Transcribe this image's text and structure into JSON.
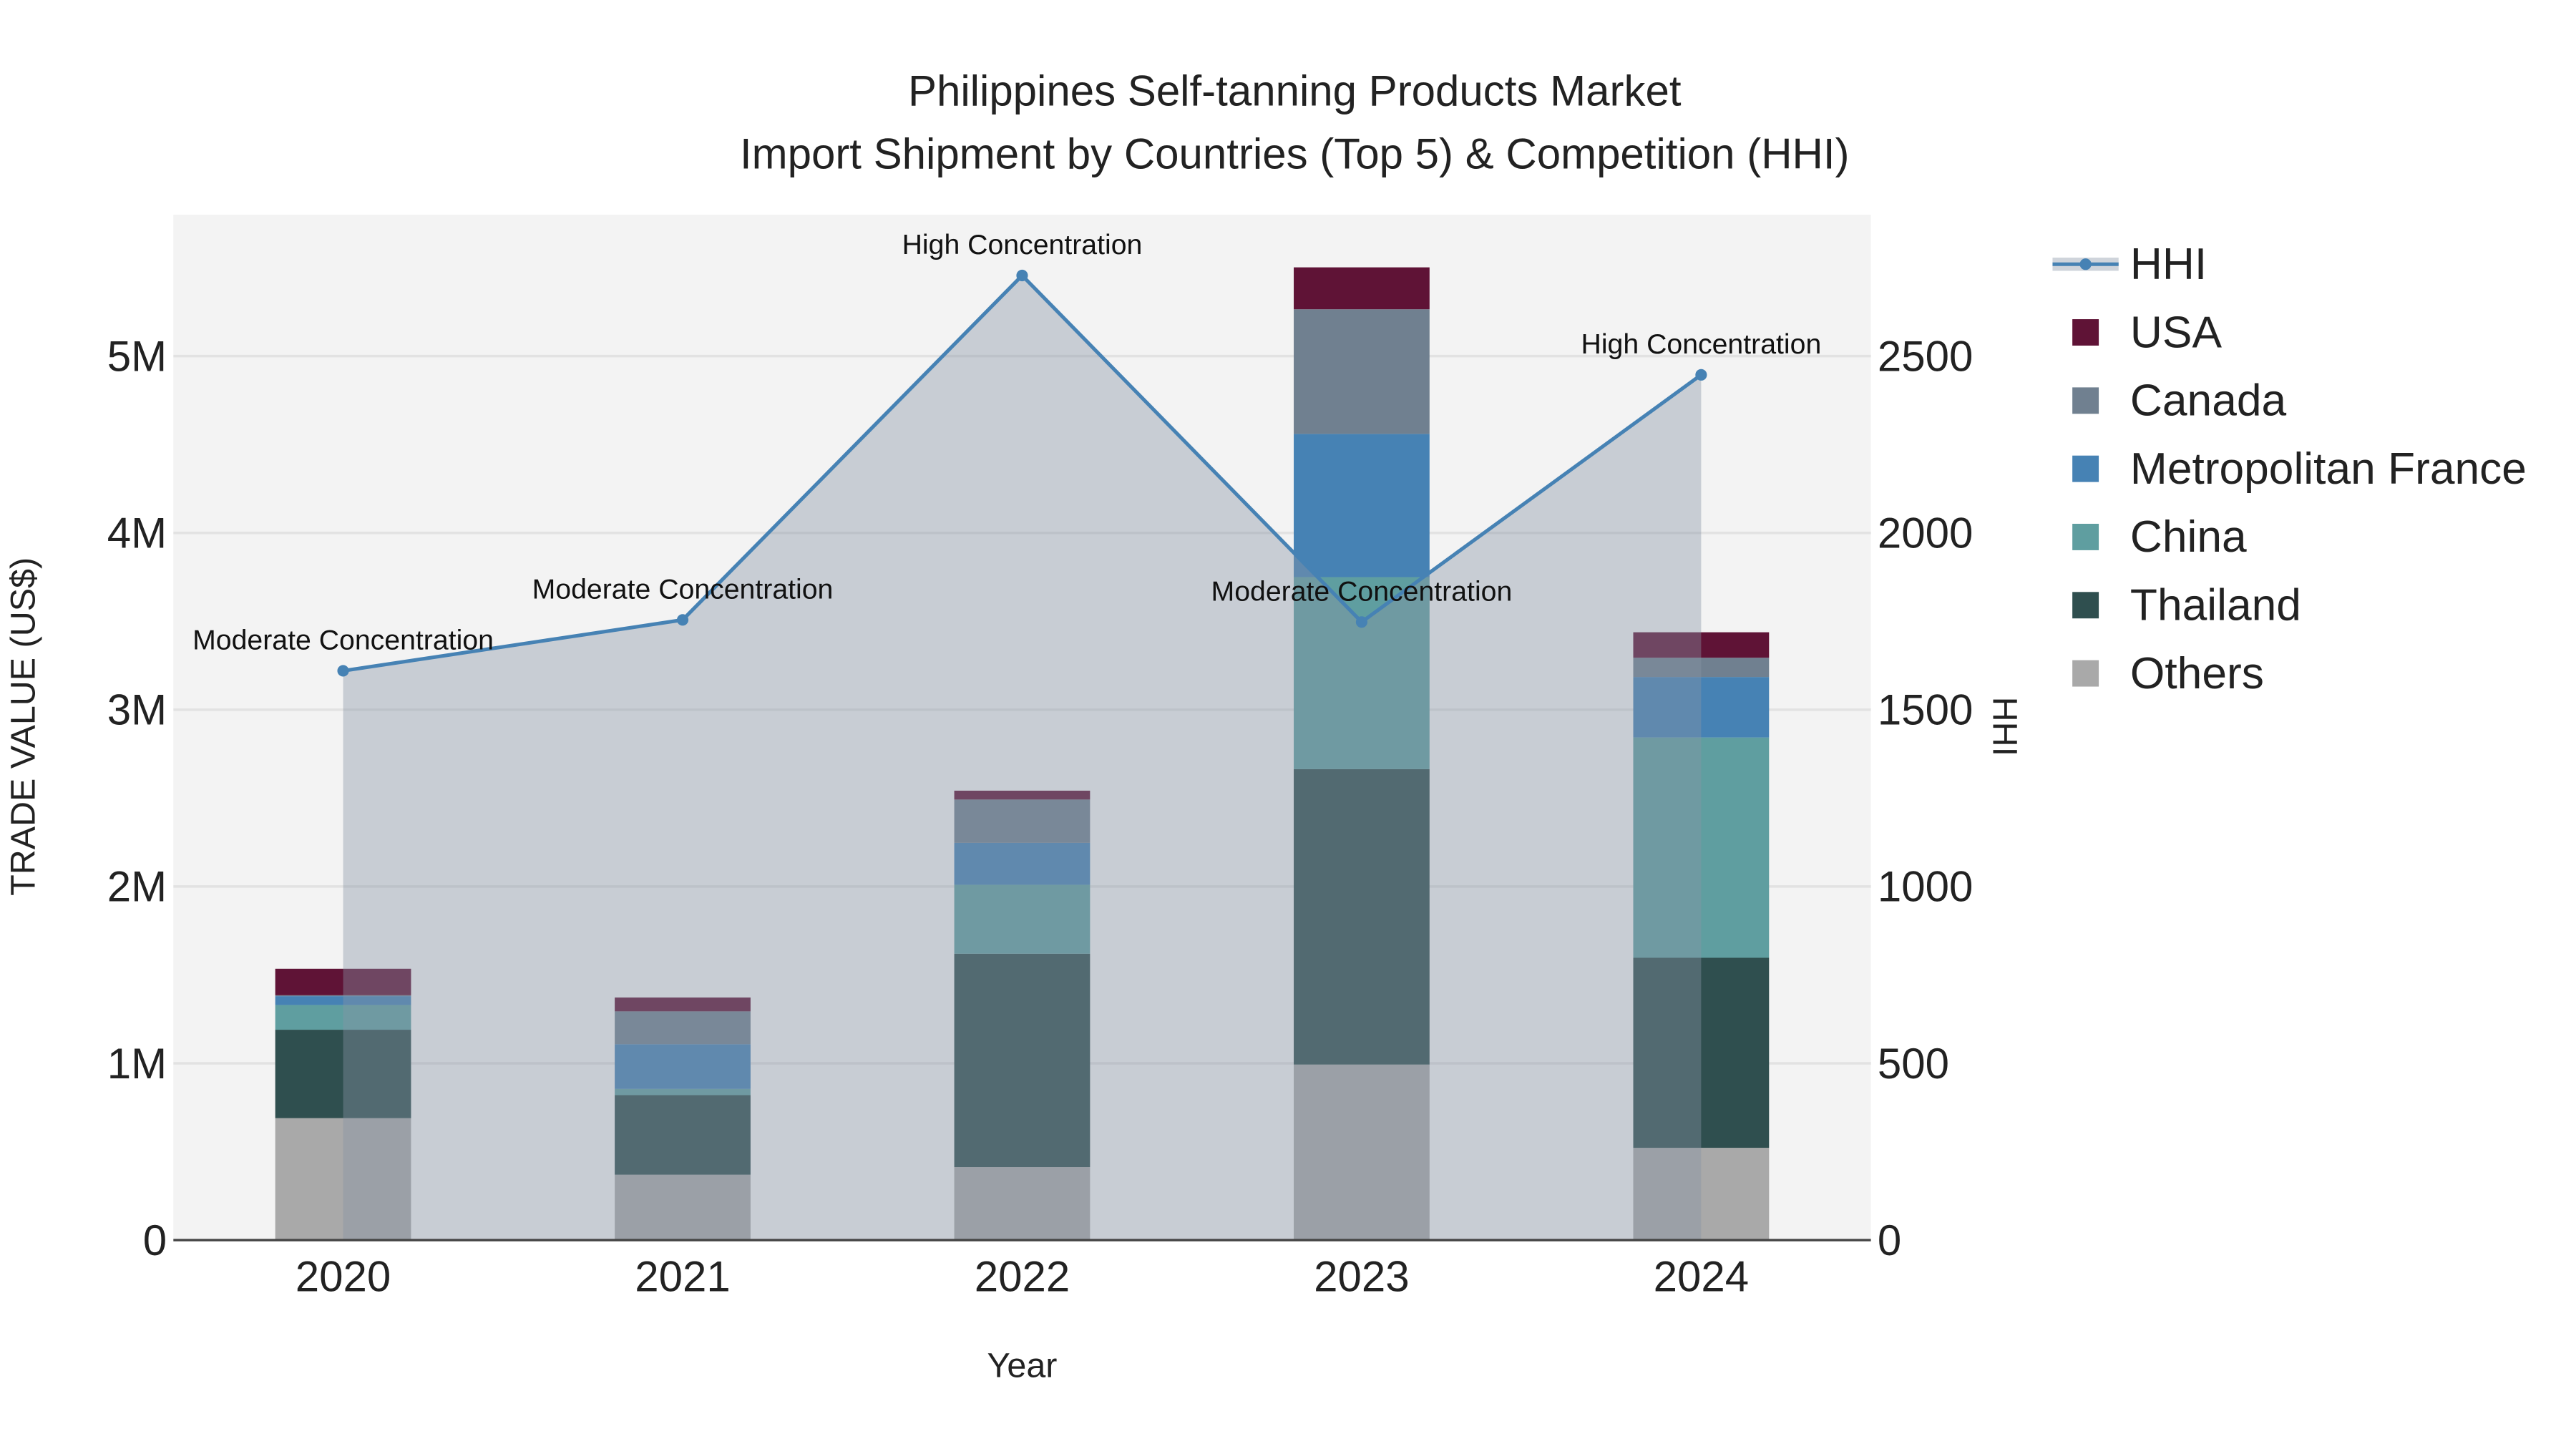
{
  "chart_data": {
    "type": "bar",
    "title": "Philippines Self-tanning Products Market",
    "subtitle": "Import Shipment by Countries (Top 5) & Competition (HHI)",
    "xlabel": "Year",
    "ylabel": "TRADE VALUE (US$)",
    "y2label": "HHI",
    "categories": [
      "2020",
      "2021",
      "2022",
      "2023",
      "2024"
    ],
    "ylim": [
      0,
      5800000
    ],
    "y2lim": [
      0,
      2900
    ],
    "yticks": [
      0,
      1000000,
      2000000,
      3000000,
      4000000,
      5000000
    ],
    "ytick_labels": [
      "0",
      "1M",
      "2M",
      "3M",
      "4M",
      "5M"
    ],
    "y2ticks": [
      0,
      500,
      1000,
      1500,
      2000,
      2500
    ],
    "y2tick_labels": [
      "0",
      "500",
      "1000",
      "1500",
      "2000",
      "2500"
    ],
    "grid": true,
    "barmode": "stack",
    "legend_placement": "right",
    "series": [
      {
        "name": "Others",
        "color": "#a9a9a9",
        "values": [
          690000,
          370000,
          413000,
          993000,
          522000
        ]
      },
      {
        "name": "Thailand",
        "color": "#2f4f4f",
        "values": [
          500000,
          450000,
          1207000,
          1671000,
          1075000
        ]
      },
      {
        "name": "China",
        "color": "#5f9ea0",
        "values": [
          140000,
          35000,
          390000,
          1086000,
          1246000
        ]
      },
      {
        "name": "Metropolitan France",
        "color": "#4682b4",
        "values": [
          50000,
          253000,
          237000,
          810000,
          342000
        ]
      },
      {
        "name": "Canada",
        "color": "#708090",
        "values": [
          5000,
          186000,
          245000,
          705000,
          109000
        ]
      },
      {
        "name": "USA",
        "color": "#5f1336",
        "values": [
          150000,
          78000,
          50000,
          237000,
          144000
        ]
      }
    ],
    "hhi": {
      "name": "HHI",
      "color": "#4682b4",
      "values": [
        1610,
        1754,
        2728,
        1748,
        2447
      ],
      "annotations": [
        "Moderate Concentration",
        "Moderate Concentration",
        "High Concentration",
        "Moderate Concentration",
        "High Concentration"
      ]
    },
    "legend": [
      "HHI",
      "USA",
      "Canada",
      "Metropolitan France",
      "China",
      "Thailand",
      "Others"
    ]
  }
}
